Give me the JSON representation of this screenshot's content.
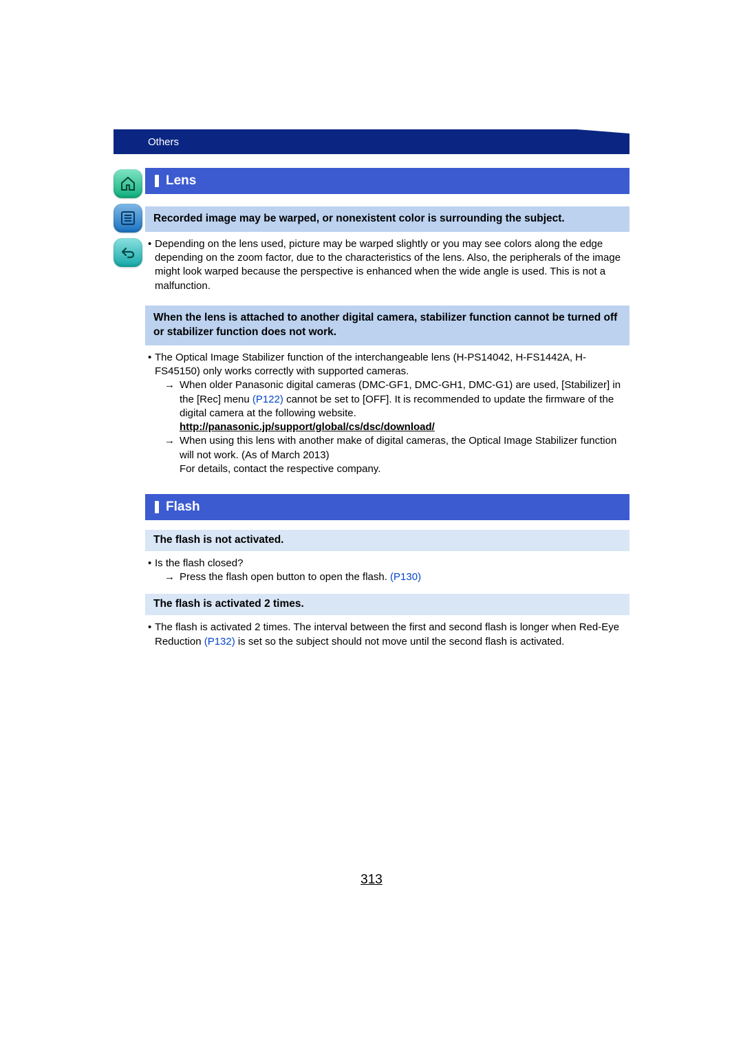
{
  "header": {
    "section": "Others"
  },
  "nav": {
    "home_icon": "home-icon",
    "toc_icon": "toc-icon",
    "back_icon": "back-icon"
  },
  "lens": {
    "title": "Lens",
    "q1": "Recorded image may be warped, or nonexistent color is surrounding the subject.",
    "a1": "Depending on the lens used, picture may be warped slightly or you may see colors along the edge depending on the zoom factor, due to the characteristics of the lens. Also, the peripherals of the image might look warped because the perspective is enhanced when the wide angle is used. This is not a malfunction.",
    "q2": "When the lens is attached to another digital camera, stabilizer function cannot be turned off or stabilizer function does not work.",
    "a2_b1": "The Optical Image Stabilizer function of the interchangeable lens (H-PS14042, H-FS1442A, H-FS45150) only works correctly with supported cameras.",
    "a2_s1a": "When older Panasonic digital cameras (DMC-GF1, DMC-GH1, DMC-G1) are used, [Stabilizer] in the [Rec] menu ",
    "a2_s1_link": "(P122)",
    "a2_s1b": " cannot be set to [OFF]. It is recommended to update the firmware of the digital camera at the following website.",
    "a2_url": "http://panasonic.jp/support/global/cs/dsc/download/",
    "a2_s2": "When using this lens with another make of digital cameras, the Optical Image Stabilizer function will not work. (As of March 2013)",
    "a2_s2b": "For details, contact the respective company."
  },
  "flash": {
    "title": "Flash",
    "q1": "The flash is not activated.",
    "a1_b1": "Is the flash closed?",
    "a1_s1a": "Press the flash open button to open the flash. ",
    "a1_s1_link": "(P130)",
    "q2": "The flash is activated 2 times.",
    "a2a": "The flash is activated 2 times. The interval between the first and second flash is longer when Red-Eye Reduction ",
    "a2_link": "(P132)",
    "a2b": " is set so the subject should not move until the second flash is activated."
  },
  "page_number": "313"
}
